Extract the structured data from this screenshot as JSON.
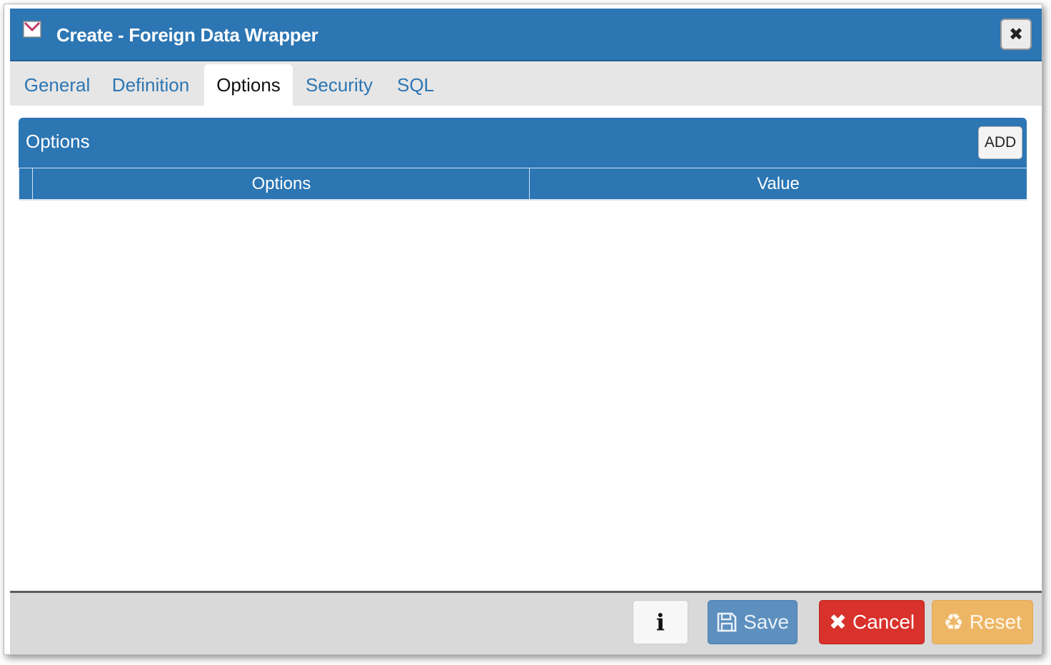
{
  "dialog": {
    "title": "Create - Foreign Data Wrapper",
    "header_icon": "fdw-envelope-icon",
    "close_icon": "close-icon"
  },
  "tabs": [
    {
      "label": "General",
      "active": false
    },
    {
      "label": "Definition",
      "active": false
    },
    {
      "label": "Options",
      "active": true
    },
    {
      "label": "Security",
      "active": false
    },
    {
      "label": "SQL",
      "active": false
    }
  ],
  "options_panel": {
    "title": "Options",
    "add_label": "ADD",
    "columns": [
      "Options",
      "Value"
    ],
    "rows": []
  },
  "footer": {
    "info_label": "i",
    "save_label": "Save",
    "cancel_label": "Cancel",
    "reset_label": "Reset"
  },
  "colors": {
    "primary": "#2c76b3",
    "save": "#5d8fbf",
    "cancel": "#d9312b",
    "reset": "#edb665"
  }
}
